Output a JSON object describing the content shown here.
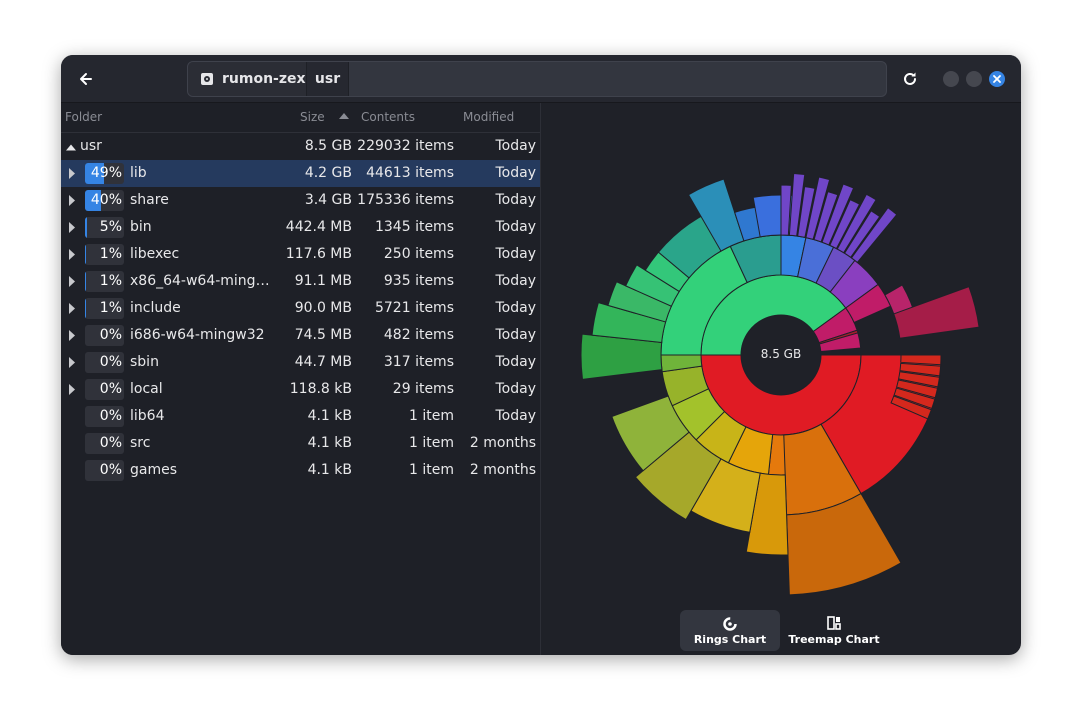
{
  "header": {
    "back_icon": "arrow-left-icon",
    "breadcrumbs": [
      {
        "label": "rumon-zex",
        "icon": "drive-icon"
      },
      {
        "label": "usr"
      }
    ],
    "refresh_icon": "refresh-icon"
  },
  "columns": {
    "folder": "Folder",
    "size": "Size",
    "contents": "Contents",
    "modified": "Modified"
  },
  "root": {
    "name": "usr",
    "size": "8.5 GB",
    "contents": "229032 items",
    "modified": "Today"
  },
  "rows": [
    {
      "pct": "49%",
      "fill": 0.49,
      "name": "lib",
      "size": "4.2 GB",
      "contents": "44613 items",
      "modified": "Today",
      "expandable": true,
      "selected": true
    },
    {
      "pct": "40%",
      "fill": 0.4,
      "name": "share",
      "size": "3.4 GB",
      "contents": "175336 items",
      "modified": "Today",
      "expandable": true
    },
    {
      "pct": "5%",
      "fill": 0.05,
      "name": "bin",
      "size": "442.4 MB",
      "contents": "1345 items",
      "modified": "Today",
      "expandable": true
    },
    {
      "pct": "1%",
      "fill": 0.01,
      "name": "libexec",
      "size": "117.6 MB",
      "contents": "250 items",
      "modified": "Today",
      "expandable": true
    },
    {
      "pct": "1%",
      "fill": 0.01,
      "name": "x86_64-w64-ming…",
      "size": "91.1 MB",
      "contents": "935 items",
      "modified": "Today",
      "expandable": true
    },
    {
      "pct": "1%",
      "fill": 0.01,
      "name": "include",
      "size": "90.0 MB",
      "contents": "5721 items",
      "modified": "Today",
      "expandable": true
    },
    {
      "pct": "0%",
      "fill": 0,
      "name": "i686-w64-mingw32",
      "size": "74.5 MB",
      "contents": "482 items",
      "modified": "Today",
      "expandable": true
    },
    {
      "pct": "0%",
      "fill": 0,
      "name": "sbin",
      "size": "44.7 MB",
      "contents": "317 items",
      "modified": "Today",
      "expandable": true
    },
    {
      "pct": "0%",
      "fill": 0,
      "name": "local",
      "size": "118.8 kB",
      "contents": "29 items",
      "modified": "Today",
      "expandable": true
    },
    {
      "pct": "0%",
      "fill": 0,
      "name": "lib64",
      "size": "4.1 kB",
      "contents": "1 item",
      "modified": "Today",
      "expandable": false
    },
    {
      "pct": "0%",
      "fill": 0,
      "name": "src",
      "size": "4.1 kB",
      "contents": "1 item",
      "modified": "2 months",
      "expandable": false
    },
    {
      "pct": "0%",
      "fill": 0,
      "name": "games",
      "size": "4.1 kB",
      "contents": "1 item",
      "modified": "2 months",
      "expandable": false
    }
  ],
  "chart": {
    "center_label": "8.5 GB",
    "colors": {
      "lib": "#e01b24",
      "share": "#2ec27e",
      "orange": "#e5790c",
      "yellow": "#e5a50a",
      "lime": "#97b32a",
      "green": "#33d17a",
      "teal": "#26a269",
      "blue": "#3584e4",
      "purple": "#813d9c",
      "magenta": "#c01c68"
    }
  },
  "view_switcher": [
    {
      "label": "Rings Chart",
      "icon": "rings-chart-icon",
      "active": true
    },
    {
      "label": "Treemap Chart",
      "icon": "treemap-chart-icon",
      "active": false
    }
  ],
  "window_controls": {
    "minimize_icon": "minimize-icon",
    "maximize_icon": "maximize-icon",
    "close_icon": "close-icon"
  }
}
